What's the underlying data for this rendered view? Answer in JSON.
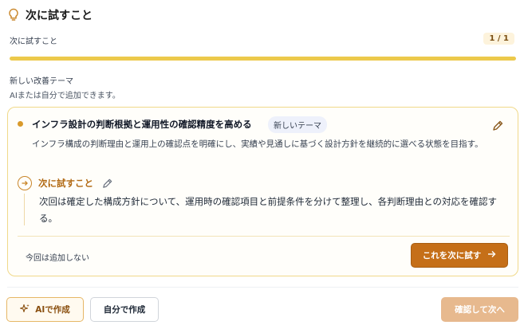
{
  "header": {
    "title": "次に試すこと",
    "icon": "lightbulb-icon"
  },
  "progress": {
    "label": "次に試すこと",
    "count": "1 / 1",
    "fraction": 1.0,
    "color": "#ecc94b"
  },
  "section": {
    "title": "新しい改善テーマ",
    "subtitle": "AIまたは自分で追加できます。"
  },
  "card": {
    "title": "インフラ設計の判断根拠と運用性の確認精度を高める",
    "badge": "新しいテーマ",
    "description": "インフラ構成の判断理由と運用上の確認点を明確にし、実績や見通しに基づく設計方針を継続的に選べる状態を目指す。",
    "next": {
      "label": "次に試すこと",
      "text": "次回は確定した構成方針について、運用時の確認項目と前提条件を分けて整理し、各判断理由との対応を確認する。"
    },
    "skip_label": "今回は追加しない",
    "try_label": "これを次に試す"
  },
  "footer": {
    "ai_label": "AIで作成",
    "self_label": "自分で作成",
    "next_label": "確認して次へ"
  },
  "colors": {
    "accent": "#c56f18",
    "accent_light": "#e7b98e",
    "progress": "#ecc94b"
  }
}
